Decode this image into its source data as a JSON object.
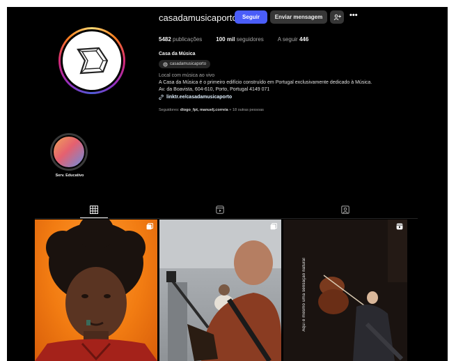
{
  "profile": {
    "username": "casadamusicaporto",
    "follow_label": "Seguir",
    "message_label": "Enviar mensagem",
    "suggest_label": "+̲",
    "more_label": "•••",
    "posts_count": "5482",
    "posts_label": "publicações",
    "followers_count": "100 mil",
    "followers_label": "seguidores",
    "following_label": "A seguir",
    "following_count": "446",
    "full_name": "Casa da Música",
    "threads_handle": "casadamusicaporto",
    "category": "Local com música ao vivo",
    "bio_line1": "A Casa da Música é o primeiro edifício construído em Portugal exclusivamente dedicado à Música.",
    "bio_line2": "Av. da Boavista, 604-610, Porto, Portugal 4149 071",
    "link": "linktr.ee/casadamusicaporto",
    "followed_by_prefix": "Seguidores:",
    "followed_by_names": "diogo_fpt, manuelj.correia",
    "followed_by_suffix": "+ 18 outras pessoas"
  },
  "highlights": [
    {
      "label": "Serv. Educativo"
    }
  ],
  "tabs": [
    {
      "name": "posts",
      "icon": "grid-icon",
      "active": true
    },
    {
      "name": "reels",
      "icon": "reels-icon",
      "active": false
    },
    {
      "name": "tagged",
      "icon": "tagged-icon",
      "active": false
    }
  ],
  "posts": [
    {
      "badge_icon": "carousel-icon",
      "description_icon": "portrait"
    },
    {
      "badge_icon": "carousel-icon",
      "description_icon": "guitar-player"
    },
    {
      "badge_icon": "reel-icon",
      "overlay_text": "Aqui é mesmo uma sensação natural"
    }
  ],
  "colors": {
    "background": "#000000",
    "primary_button": "#4a5df9",
    "secondary_button": "#363636",
    "muted_text": "#a8a8a8"
  }
}
